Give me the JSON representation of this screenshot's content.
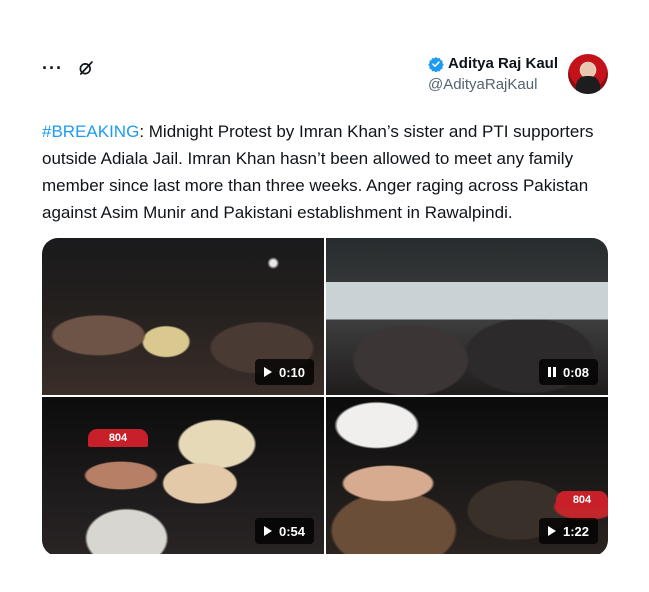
{
  "header": {
    "more_label": "···",
    "author": {
      "display_name": "Aditya Raj Kaul",
      "handle": "@AdityaRajKaul",
      "verified_color": "#1d9bf0"
    }
  },
  "tweet": {
    "hashtag": "#BREAKING",
    "text": ": Midnight Protest by Imran Khan’s sister and PTI supporters outside Adiala Jail. Imran Khan hasn’t been allowed to meet any family member since last more than three weeks. Anger raging across Pakistan against Asim Munir and Pakistani establishment in Rawalpindi."
  },
  "media": [
    {
      "duration": "0:10",
      "state_icon": "play-icon"
    },
    {
      "duration": "0:08",
      "state_icon": "pause-icon"
    },
    {
      "duration": "0:54",
      "state_icon": "play-icon",
      "cap_text": "804"
    },
    {
      "duration": "1:22",
      "state_icon": "play-icon",
      "cap_text": "804"
    }
  ],
  "colors": {
    "accent": "#1d9bf0",
    "text": "#0f1419",
    "secondary": "#536471"
  }
}
